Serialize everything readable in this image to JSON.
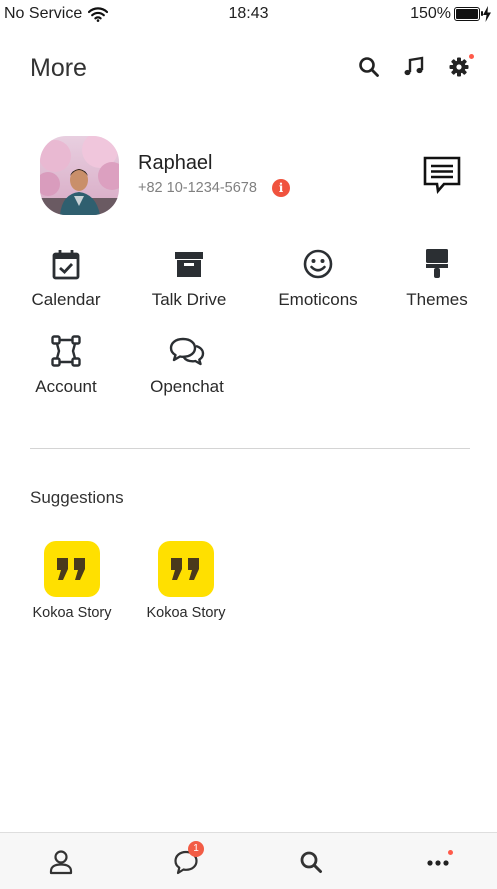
{
  "status_bar": {
    "carrier": "No Service",
    "time": "18:43",
    "battery_percent": "150%",
    "battery_level": 1.0
  },
  "header": {
    "title": "More",
    "icons": [
      "search-icon",
      "music-icon",
      "settings-icon"
    ]
  },
  "profile": {
    "name": "Raphael",
    "phone": "+82 10-1234-5678",
    "info_icon_glyph": "i"
  },
  "menu": {
    "items": [
      {
        "label": "Calendar",
        "icon": "calendar-icon"
      },
      {
        "label": "Talk Drive",
        "icon": "archive-box-icon"
      },
      {
        "label": "Emoticons",
        "icon": "smiley-icon"
      },
      {
        "label": "Themes",
        "icon": "paint-brush-icon"
      },
      {
        "label": "Account",
        "icon": "account-nodes-icon"
      },
      {
        "label": "Openchat",
        "icon": "chat-bubbles-icon"
      }
    ]
  },
  "suggestions": {
    "title": "Suggestions",
    "items": [
      {
        "label": "Kokoa Story",
        "icon": "quote-icon"
      },
      {
        "label": "Kokoa Story",
        "icon": "quote-icon"
      }
    ]
  },
  "bottom_nav": {
    "items": [
      "person-icon",
      "chat-icon",
      "search-icon",
      "more-icon"
    ],
    "chat_badge": "1"
  },
  "colors": {
    "accent_yellow": "#ffe000",
    "badge_red": "#f25c45",
    "text_dark": "#1e1e1e"
  }
}
